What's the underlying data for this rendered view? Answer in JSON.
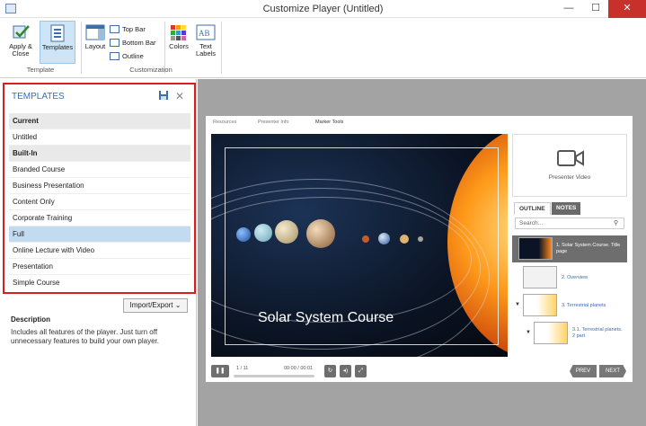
{
  "window": {
    "title": "Customize Player (Untitled)",
    "minimize": "—",
    "maximize": "☐",
    "close": "✕"
  },
  "ribbon": {
    "apply_close": "Apply & Close",
    "templates": "Templates",
    "layout": "Layout",
    "top_bar": "Top Bar",
    "bottom_bar": "Bottom Bar",
    "outline": "Outline",
    "colors": "Colors",
    "text_labels": "Text Labels",
    "group_template": "Template",
    "group_customization": "Customization"
  },
  "templates": {
    "heading": "TEMPLATES",
    "items": [
      {
        "label": "Current",
        "kind": "section"
      },
      {
        "label": "Untitled",
        "kind": "item"
      },
      {
        "label": "Built-In",
        "kind": "section"
      },
      {
        "label": "Branded Course",
        "kind": "item"
      },
      {
        "label": "Business Presentation",
        "kind": "item"
      },
      {
        "label": "Content Only",
        "kind": "item"
      },
      {
        "label": "Corporate Training",
        "kind": "item"
      },
      {
        "label": "Full",
        "kind": "selected"
      },
      {
        "label": "Online Lecture with Video",
        "kind": "item"
      },
      {
        "label": "Presentation",
        "kind": "item"
      },
      {
        "label": "Simple Course",
        "kind": "item"
      }
    ],
    "import_export": "Import/Export",
    "description_heading": "Description",
    "description": "Includes all features of the player. Just turn off unnecessary features to build your own player."
  },
  "player": {
    "tabs": [
      "Resources",
      "Presenter Info",
      "Marker Tools"
    ],
    "slide_title": "Solar System Course",
    "presenter_video": "Presenter Video",
    "outline_tab": "OUTLINE",
    "notes_tab": "NOTES",
    "search_placeholder": "Search...",
    "outline": [
      {
        "label": "1. Solar System Course. Title page"
      },
      {
        "label": "2. Overview"
      },
      {
        "label": "3. Terrestrial planets"
      },
      {
        "label": "3.1. Terrestrial planets. 2 part"
      }
    ],
    "slide_counter": "1 / 11",
    "time": "00:00 / 00:01",
    "prev": "PREV",
    "next": "NEXT"
  }
}
